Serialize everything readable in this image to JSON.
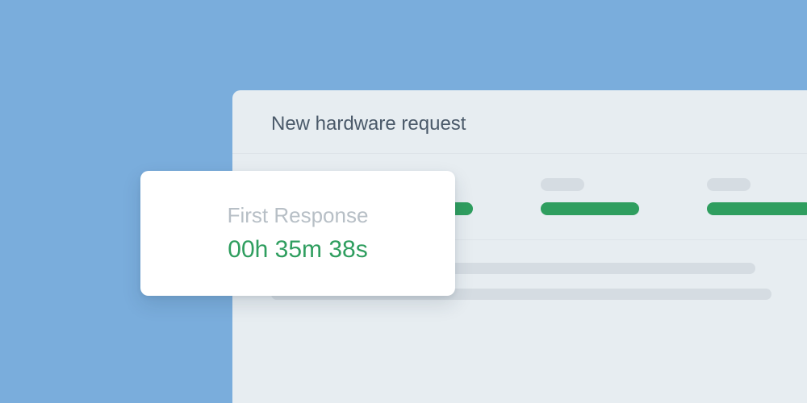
{
  "panel": {
    "title": "New hardware request"
  },
  "card": {
    "label": "First Response",
    "time": "00h 35m 38s"
  },
  "colors": {
    "background": "#7aaddc",
    "panel": "#e7edf1",
    "accent": "#2f9e5f",
    "muted_bar": "#d5dce2",
    "title_text": "#4b5a6a",
    "card_label": "#b7bfc6"
  }
}
